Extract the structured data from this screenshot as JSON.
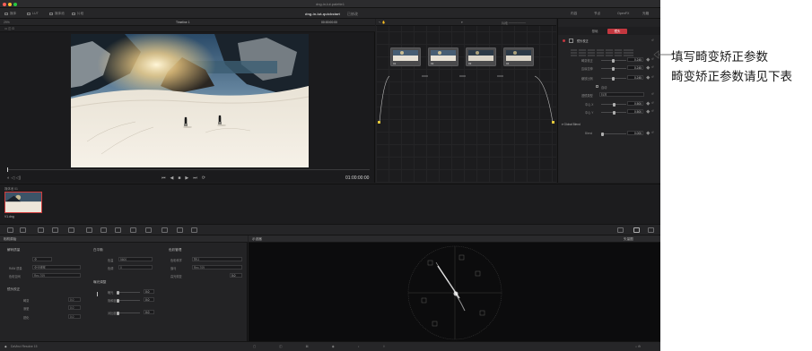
{
  "window": {
    "title": "dng-in-lut.palette1"
  },
  "toolbar": {
    "media": "媒体",
    "lut": "LUT",
    "media_pool": "媒体池",
    "clip": "片段",
    "project_title": "dng-in-lut-quickstart",
    "project_sub": "已修改",
    "right_1": "内容",
    "right_2": "节点",
    "right_3": "OpenFX",
    "right_4": "光箱"
  },
  "viewer": {
    "zoom": "29%",
    "timeline_name": "Timeline 1",
    "clip_timecode": "00:00:00:00",
    "timecode": "01:00:00:00"
  },
  "node_graph": {
    "node_labels": [
      "01",
      "02",
      "03",
      "04"
    ]
  },
  "inspector": {
    "tab_1": "基础",
    "tab_2": "镜头",
    "section": "镜头校正",
    "row_1_label": "畸变校正",
    "row_1_value": "0.245",
    "row_2_label": "边缘拉伸",
    "row_2_value": "0.245",
    "row_3_label": "缩放比例",
    "row_3_value": "0.245",
    "checkbox_label": "自动",
    "row_4_label": "透镜类型",
    "row_4_value": "标准",
    "row_5_label": "中心 X",
    "row_5_value": "0.500",
    "row_6_label": "中心 Y",
    "row_6_value": "0.500",
    "global_section": "Global Blend",
    "row_7_label": "Blend",
    "row_7_value": "0.000"
  },
  "media": {
    "bin_label": "媒体池 01",
    "clip_name": "V1.dng"
  },
  "bottom_left": {
    "title": "相机原始",
    "col1_title": "解码质量",
    "col1_field_1": "全",
    "col1_label_2": "RAW 质量",
    "col1_field_2": "全分辨率",
    "col1_label_3": "色彩空间",
    "col1_field_3": "Rec.709",
    "col2_title": "白平衡",
    "col2_label_1": "色温",
    "col2_field_1": "5600",
    "col2_label_2": "色调",
    "col2_field_2": "0",
    "col2_title_2": "曝光调整",
    "col2_slider_1": "曝光",
    "col2_val_1": "0.0",
    "col2_slider_2": "饱和度",
    "col2_val_2": "0.0",
    "col2_slider_3": "对比度",
    "col2_val_3": "0.0",
    "col3_title": "色彩管理",
    "col3_label_1": "色彩科学",
    "col3_field_1": "默认",
    "col3_label_2": "伽马",
    "col3_field_2": "Rec.709",
    "col3_label_3": "高光恢复",
    "col3_val_3": "0.0",
    "col1_title_2": "镜头校正",
    "col1_b_1": "畸变",
    "col1_b_1_val": "0.0",
    "col1_b_2": "渐晕",
    "col1_b_2_val": "0.0",
    "col1_b_3": "锐化",
    "col1_b_3_val": "0.0"
  },
  "scope": {
    "title": "示波器",
    "mode": "矢量图"
  },
  "status": {
    "app_name": "DaVinci Resolve 15"
  },
  "annotations": {
    "line_1": "填写畸变矫正参数",
    "line_2": "畸变矫正参数请见下表"
  }
}
